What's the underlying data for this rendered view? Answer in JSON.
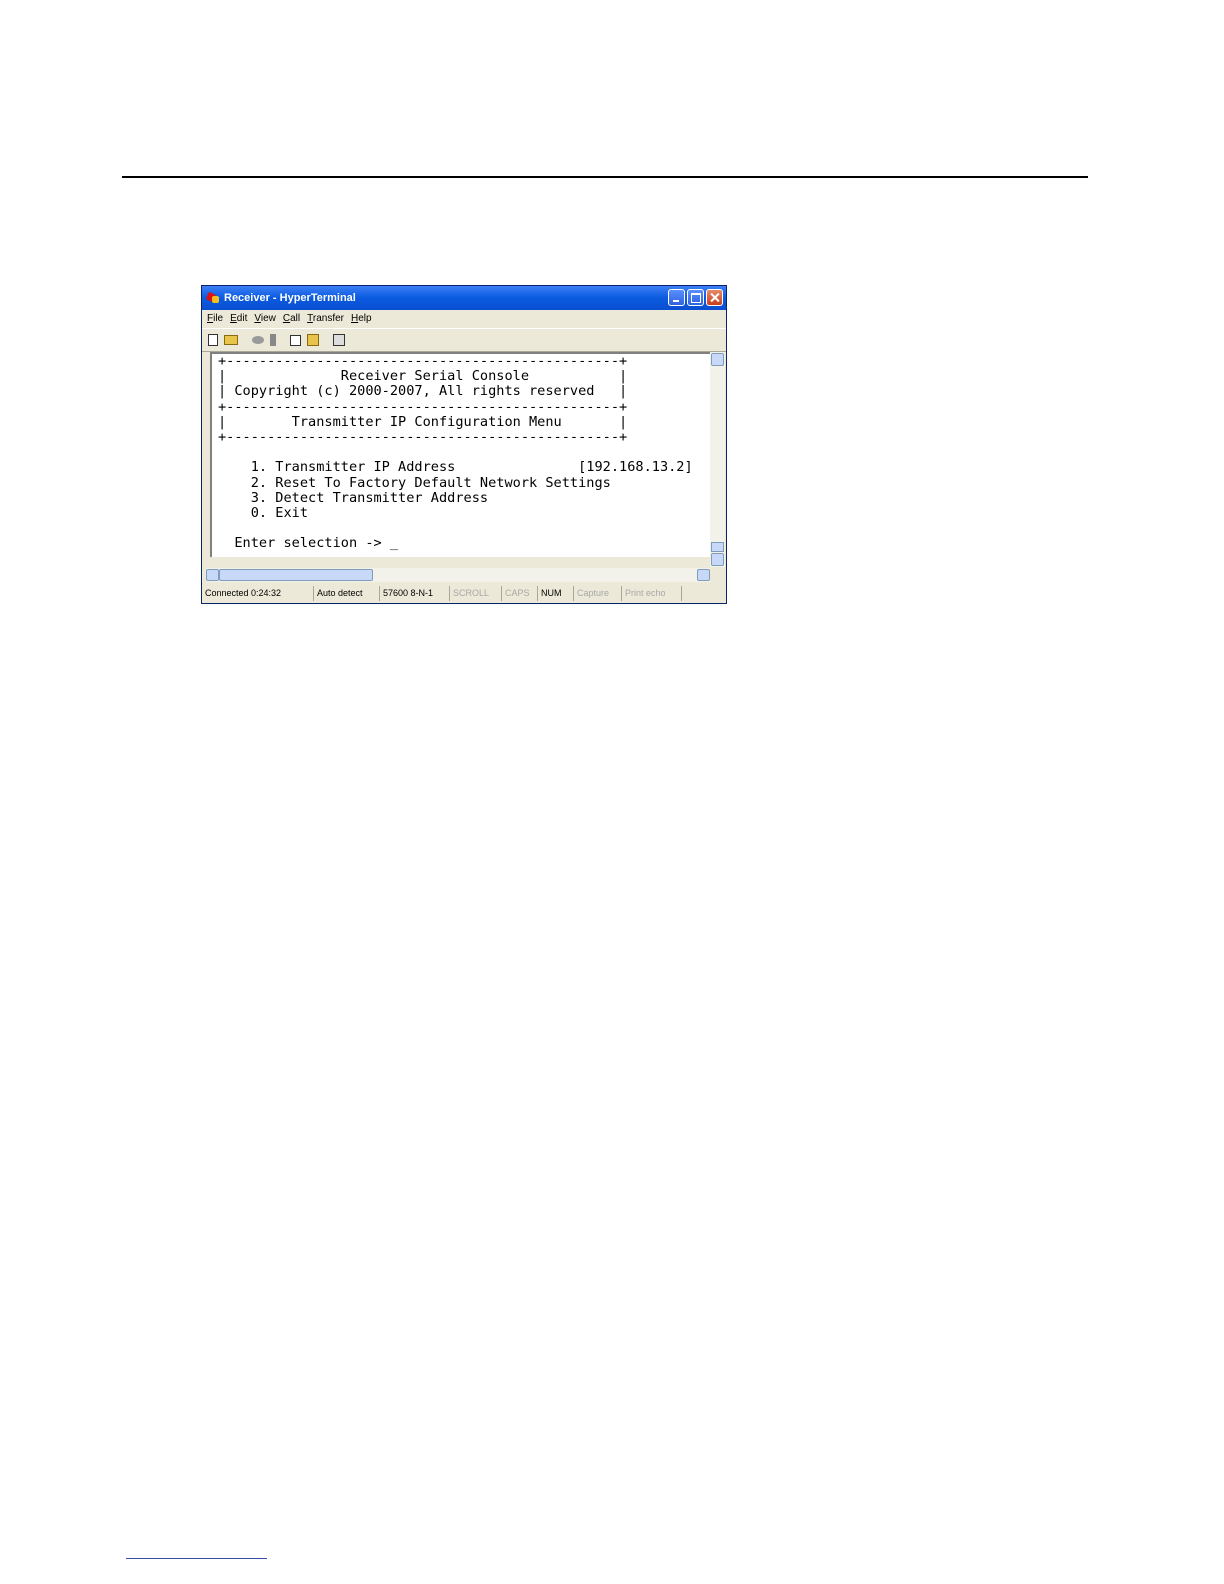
{
  "window": {
    "title": "Receiver - HyperTerminal"
  },
  "menu": {
    "items": [
      "File",
      "Edit",
      "View",
      "Call",
      "Transfer",
      "Help"
    ]
  },
  "toolbar": {
    "icons": [
      "new-icon",
      "open-icon",
      "call-icon",
      "hangup-icon",
      "send-icon",
      "receive-icon",
      "properties-icon"
    ]
  },
  "terminal": {
    "lines": [
      "+------------------------------------------------+",
      "|              Receiver Serial Console           |",
      "| Copyright (c) 2000-2007, All rights reserved   |",
      "+------------------------------------------------+",
      "|        Transmitter IP Configuration Menu       |",
      "+------------------------------------------------+",
      "",
      "    1. Transmitter IP Address               [192.168.13.2]",
      "    2. Reset To Factory Default Network Settings",
      "    3. Detect Transmitter Address",
      "    0. Exit",
      "",
      "  Enter selection -> _"
    ]
  },
  "status": {
    "connected": "Connected 0:24:32",
    "detect": "Auto detect",
    "port": "57600 8-N-1",
    "scroll": "SCROLL",
    "caps": "CAPS",
    "num": "NUM",
    "capture": "Capture",
    "print_echo": "Print echo"
  }
}
